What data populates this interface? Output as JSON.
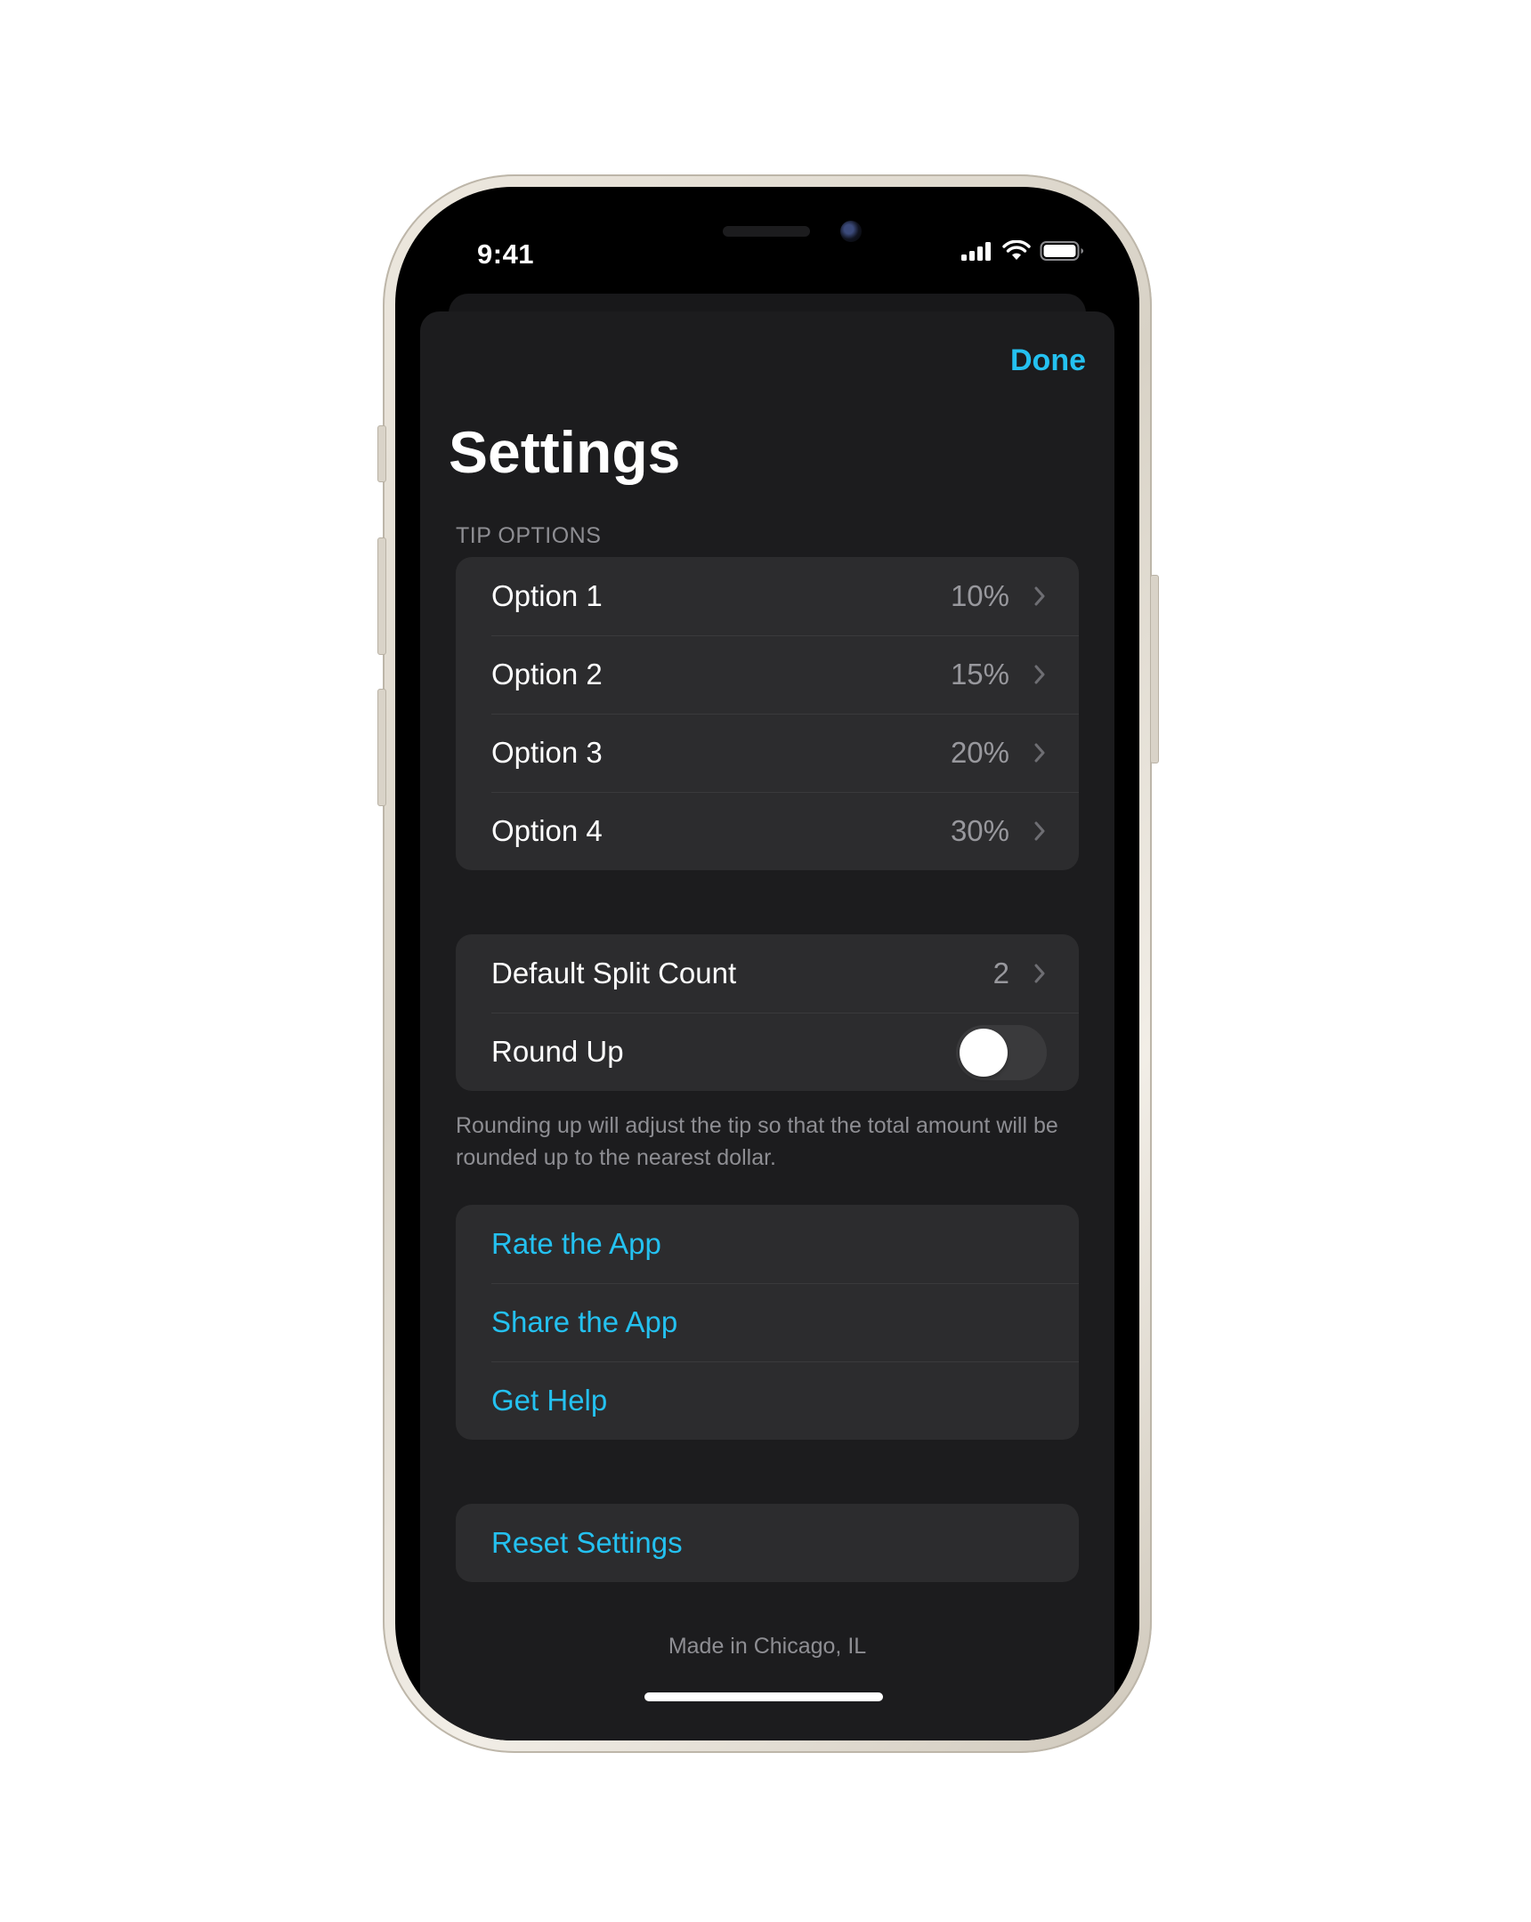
{
  "status_bar": {
    "time": "9:41",
    "icons": [
      "cellular-signal-icon",
      "wifi-icon",
      "battery-icon"
    ]
  },
  "nav": {
    "done_label": "Done",
    "title": "Settings"
  },
  "tip_options": {
    "header": "TIP OPTIONS",
    "rows": [
      {
        "label": "Option 1",
        "value": "10%"
      },
      {
        "label": "Option 2",
        "value": "15%"
      },
      {
        "label": "Option 3",
        "value": "20%"
      },
      {
        "label": "Option 4",
        "value": "30%"
      }
    ]
  },
  "split": {
    "default_split_label": "Default Split Count",
    "default_split_value": "2",
    "round_up_label": "Round Up",
    "round_up_enabled": false,
    "footnote": "Rounding up will adjust the tip so that the total amount will be rounded up to the nearest dollar."
  },
  "links": {
    "items": [
      "Rate the App",
      "Share the App",
      "Get Help"
    ]
  },
  "reset": {
    "label": "Reset Settings"
  },
  "footer": {
    "credits": "Made in Chicago, IL"
  },
  "colors": {
    "accent": "#24c1f0",
    "background": "#1c1c1e",
    "cell": "#2c2c2e",
    "secondary_text": "#8e8e93"
  }
}
